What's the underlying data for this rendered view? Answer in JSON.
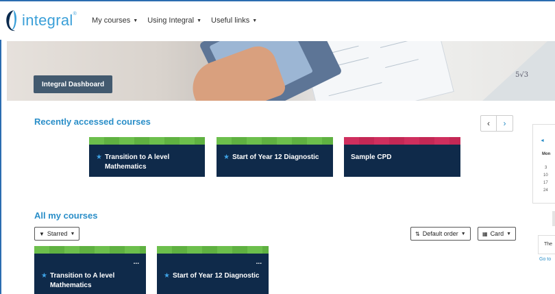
{
  "brand": {
    "name": "integral",
    "tm": "®"
  },
  "nav": {
    "items": [
      {
        "label": "My courses"
      },
      {
        "label": "Using Integral"
      },
      {
        "label": "Useful links"
      }
    ]
  },
  "banner": {
    "math_text": "5√3",
    "button_label": "Integral Dashboard"
  },
  "recent": {
    "title": "Recently accessed courses",
    "prev_icon": "‹",
    "next_icon": "›",
    "courses": [
      {
        "name": "Transition to A level Mathematics",
        "starred": true,
        "color": "#6cbf4c"
      },
      {
        "name": "Start of Year 12 Diagnostic",
        "starred": true,
        "color": "#6cbf4c"
      },
      {
        "name": "Sample CPD",
        "starred": false,
        "color": "#cf2f5e"
      }
    ]
  },
  "all_courses": {
    "title": "All my courses",
    "filter_label": "Starred",
    "sort_label": "Default order",
    "view_label": "Card",
    "courses": [
      {
        "name": "Transition to A level Mathematics",
        "starred": true,
        "menu": "..."
      },
      {
        "name": "Start of Year 12 Diagnostic",
        "starred": true,
        "menu": "..."
      }
    ]
  },
  "calendar": {
    "prev_icon": "◄",
    "weekday": "Mon",
    "days": [
      "3",
      "10",
      "17",
      "24"
    ]
  },
  "side": {
    "box_text": "The",
    "link_text": "Go to"
  },
  "colors": {
    "accent": "#2a8ec8",
    "card_bg": "#0f2a4a",
    "green": "#6cbf4c",
    "pink": "#cf2f5e",
    "dash_btn": "#435a6f"
  }
}
